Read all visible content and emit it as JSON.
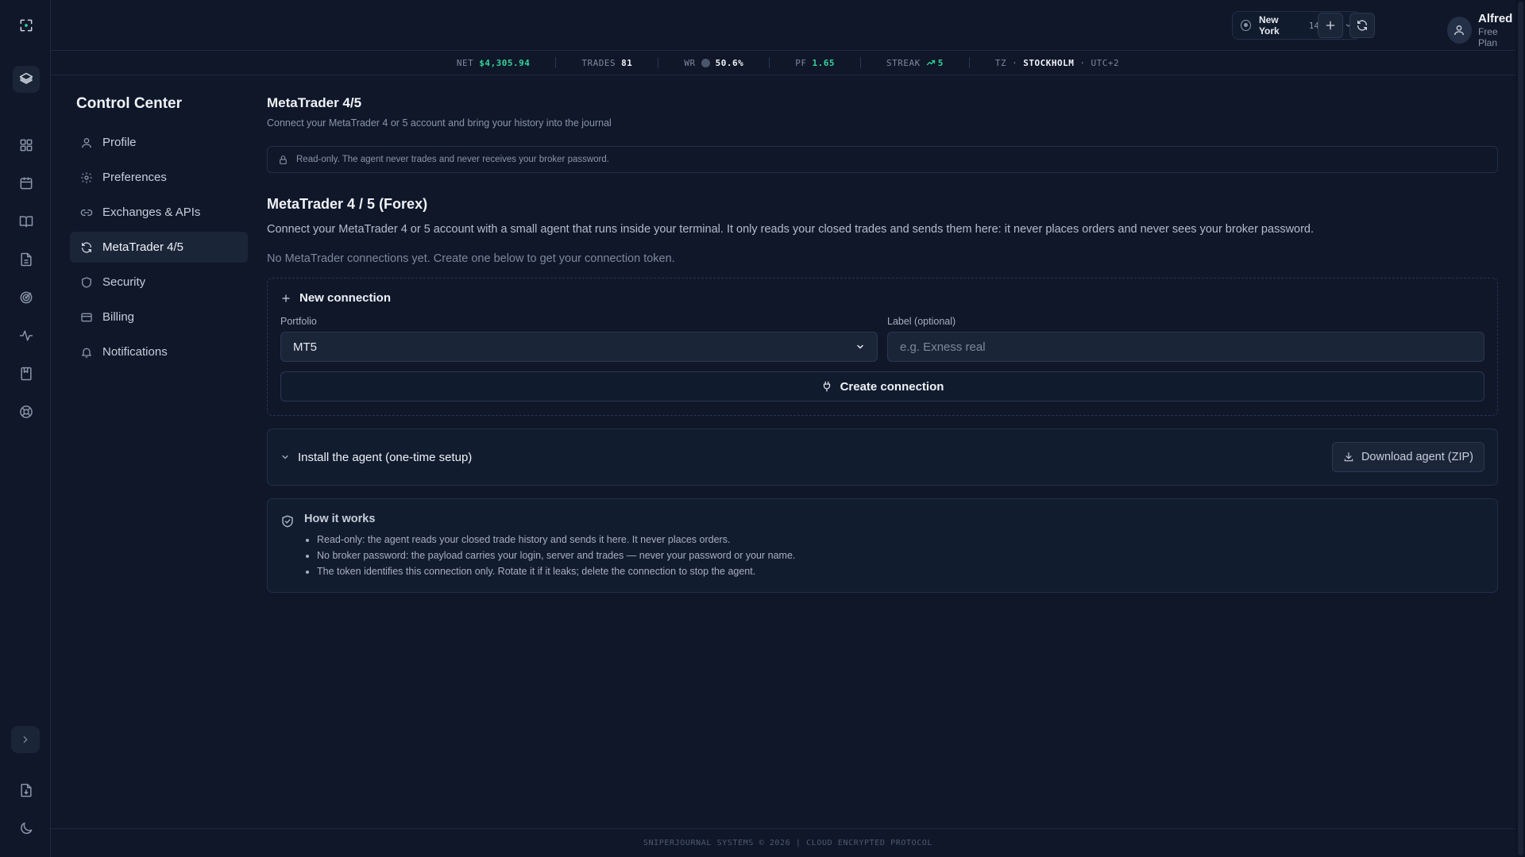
{
  "rail": {
    "icons": [
      "brand-logo-icon",
      "layers-icon",
      "dashboard-icon",
      "calendar-icon",
      "book-icon",
      "document-icon",
      "target-icon",
      "activity-icon",
      "bookmark-icon",
      "help-icon",
      "expand-icon",
      "download-file-icon",
      "moon-icon"
    ]
  },
  "header": {
    "session_city": "New York",
    "session_time": "14:28",
    "user_name": "Alfred",
    "user_plan": "Free Plan"
  },
  "stats": {
    "net_label": "NET",
    "net_value": "$4,305.94",
    "trades_label": "TRADES",
    "trades_value": "81",
    "wr_label": "WR",
    "wr_value": "50.6%",
    "pf_label": "PF",
    "pf_value": "1.65",
    "streak_label": "STREAK",
    "streak_value": "5",
    "tz_label": "TZ",
    "tz_sep": "·",
    "tz_city": "STOCKHOLM",
    "tz_offset": "UTC+2"
  },
  "nav": {
    "title": "Control Center",
    "items": [
      {
        "label": "Profile"
      },
      {
        "label": "Preferences"
      },
      {
        "label": "Exchanges & APIs"
      },
      {
        "label": "MetaTrader 4/5"
      },
      {
        "label": "Security"
      },
      {
        "label": "Billing"
      },
      {
        "label": "Notifications"
      }
    ]
  },
  "main": {
    "title": "MetaTrader 4/5",
    "subtitle": "Connect your MetaTrader 4 or 5 account and bring your history into the journal",
    "notice": "Read-only. The agent never trades and never receives your broker password.",
    "section_title": "MetaTrader 4 / 5 (Forex)",
    "description": "Connect your MetaTrader 4 or 5 account with a small agent that runs inside your terminal. It only reads your closed trades and sends them here: it never places orders and never sees your broker password.",
    "empty_state": "No MetaTrader connections yet. Create one below to get your connection token.",
    "new_connection": {
      "heading": "New connection",
      "portfolio_label": "Portfolio",
      "portfolio_value": "MT5",
      "label_label": "Label (optional)",
      "label_placeholder": "e.g. Exness real",
      "create_button": "Create connection"
    },
    "install": {
      "heading": "Install the agent (one-time setup)",
      "download_button": "Download agent (ZIP)"
    },
    "how": {
      "title": "How it works",
      "points": [
        "Read-only: the agent reads your closed trade history and sends it here. It never places orders.",
        "No broker password: the payload carries your login, server and trades — never your password or your name.",
        "The token identifies this connection only. Rotate it if it leaks; delete the connection to stop the agent."
      ]
    }
  },
  "footer": "SNIPERJOURNAL SYSTEMS © 2026 | CLOUD ENCRYPTED PROTOCOL",
  "colors": {
    "background": "#0f1729",
    "accent_green": "#34d399",
    "panel": "#1b2538"
  }
}
